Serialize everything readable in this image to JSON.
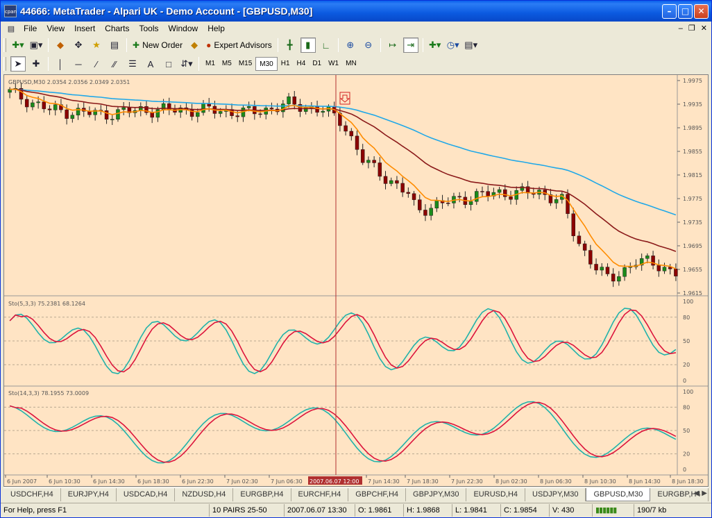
{
  "window": {
    "title": "44666: MetaTrader - Alpari UK - Demo Account - [GBPUSD,M30]",
    "icon_label": "cpan"
  },
  "menu": [
    "File",
    "View",
    "Insert",
    "Charts",
    "Tools",
    "Window",
    "Help"
  ],
  "toolbar": {
    "new_order": "New Order",
    "expert_advisors": "Expert Advisors",
    "text_tool": "A"
  },
  "timeframes": [
    "M1",
    "M5",
    "M15",
    "M30",
    "H1",
    "H4",
    "D1",
    "W1",
    "MN"
  ],
  "selected_timeframe": "M30",
  "chart": {
    "main_label": "GBPUSD,M30  2.0354 2.0356 2.0349 2.0351",
    "price_ticks": [
      "1.9975",
      "1.9935",
      "1.9895",
      "1.9855",
      "1.9815",
      "1.9775",
      "1.9735",
      "1.9695",
      "1.9655",
      "1.9615"
    ],
    "sto1_label": "Sto(5,3,3) 75.2381 68.1264",
    "sto2_label": "Sto(14,3,3) 78.1955 73.0009",
    "sto_ticks": [
      "100",
      "80",
      "50",
      "20",
      "0"
    ],
    "time_ticks": [
      "6 Jun 2007",
      "6 Jun 10:30",
      "6 Jun 14:30",
      "6 Jun 18:30",
      "6 Jun 22:30",
      "7 Jun 02:30",
      "7 Jun 06:30",
      "7 Jun 14:30",
      "7 Jun 18:30",
      "7 Jun 22:30",
      "8 Jun 02:30",
      "8 Jun 06:30",
      "8 Jun 10:30",
      "8 Jun 14:30",
      "8 Jun 18:30"
    ],
    "cursor_time": "2007.06.07 12:00",
    "colors": {
      "background": "#FFE4C4",
      "bull": "#1a8a1a",
      "bear": "#8B0000",
      "ma_fast": "#FF8C00",
      "ma_mid": "#8B1A1A",
      "ma_slow": "#20A8E8",
      "sto_main": "#20B2AA",
      "sto_signal": "#DC143C",
      "cursor": "#B03030"
    }
  },
  "tabs": [
    "USDCHF,H4",
    "EURJPY,H4",
    "USDCAD,H4",
    "NZDUSD,H4",
    "EURGBP,H4",
    "EURCHF,H4",
    "GBPCHF,H4",
    "GBPJPY,M30",
    "EURUSD,H4",
    "USDJPY,M30",
    "GBPUSD,M30",
    "EURGBP,H4"
  ],
  "active_tab": "GBPUSD,M30",
  "status": {
    "help": "For Help, press F1",
    "profile": "10 PAIRS 25-50",
    "datetime": "2007.06.07 13:30",
    "open": "O: 1.9861",
    "high": "H: 1.9868",
    "low": "L: 1.9841",
    "close": "C: 1.9854",
    "volume": "V: 430",
    "traffic": "190/7 kb"
  }
}
